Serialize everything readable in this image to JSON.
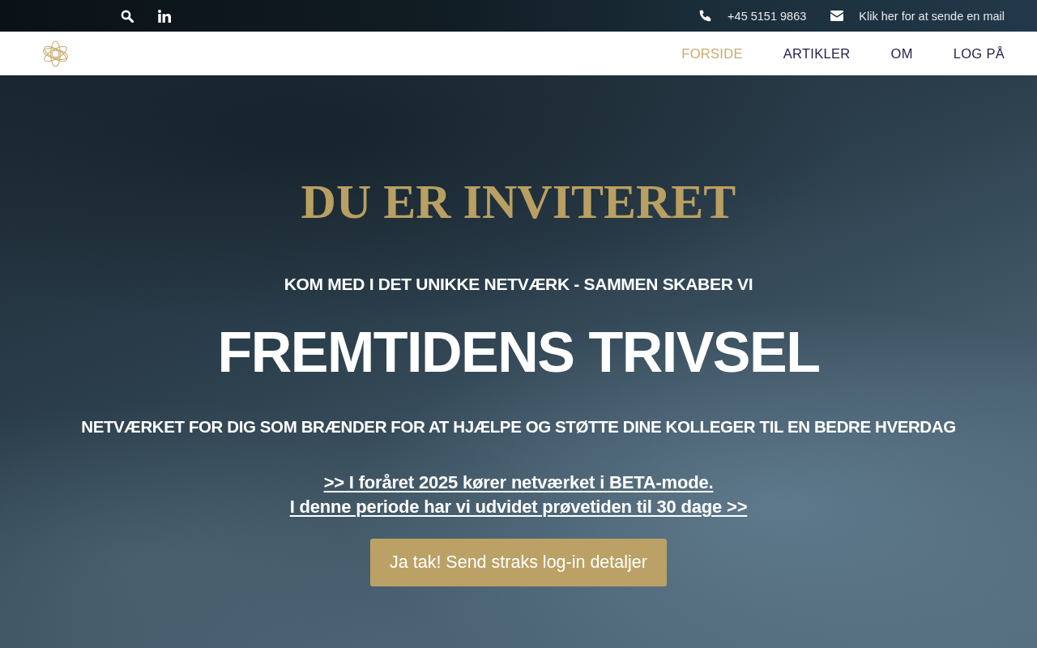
{
  "top_bar": {
    "phone": "+45 5151 9863",
    "email_link": "Klik her for at sende en mail"
  },
  "nav": {
    "items": [
      {
        "label": "FORSIDE",
        "selected": true
      },
      {
        "label": "ARTIKLER",
        "selected": false
      },
      {
        "label": "OM",
        "selected": false
      },
      {
        "label": "LOG PÅ",
        "selected": false
      }
    ]
  },
  "hero": {
    "title": "DU ER INVITERET",
    "kicker": "KOM MED I DET UNIKKE NETVÆRK - SAMMEN SKABER VI",
    "headline": "FREMTIDENS TRIVSEL",
    "tagline": "NETVÆRKET FOR DIG SOM BRÆNDER FOR AT HJÆLPE OG STØTTE DINE KOLLEGER TIL EN BEDRE HVERDAG",
    "notice_links": [
      ">> I foråret 2025 kører netværket i BETA-mode.",
      "I denne periode har vi udvidet prøvetiden til 30 dage >>"
    ],
    "cta_button": "Ja tak! Send straks log-in detaljer"
  }
}
